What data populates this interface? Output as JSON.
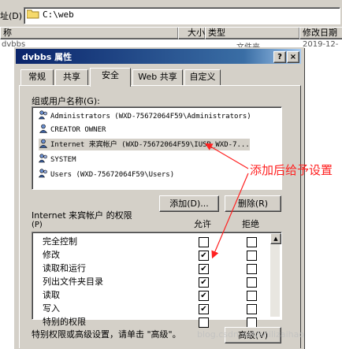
{
  "address_bar": {
    "label": "址(D)",
    "path": "C:\\web"
  },
  "file_list": {
    "columns": [
      "称",
      "大小",
      "类型",
      "修改日期"
    ],
    "row": {
      "name": "dvbbs",
      "type": "文件夹",
      "date": "2019-12-"
    }
  },
  "dialog": {
    "title": "dvbbs 属性",
    "help_label": "?",
    "close_label": "×",
    "tabs": [
      "常规",
      "共享",
      "安全",
      "Web 共享",
      "自定义"
    ],
    "active_tab": "安全",
    "users_label": "组或用户名称(G):",
    "users": [
      "Administrators (WXD-75672064F59\\Administrators)",
      "CREATOR OWNER",
      "Internet 来宾帐户 (WXD-75672064F59\\IUSR_WXD-7...",
      "SYSTEM",
      "Users (WXD-75672064F59\\Users)"
    ],
    "selected_user_index": 2,
    "add_button": "添加(D)...",
    "remove_button": "删除(R)",
    "perm_label": "Internet 来宾帐户 的权限",
    "perm_label_key": "(P)",
    "allow_header": "允许",
    "deny_header": "拒绝",
    "permissions": [
      {
        "name": "完全控制",
        "allow": false,
        "deny": false
      },
      {
        "name": "修改",
        "allow": true,
        "deny": false
      },
      {
        "name": "读取和运行",
        "allow": true,
        "deny": false
      },
      {
        "name": "列出文件夹目录",
        "allow": true,
        "deny": false
      },
      {
        "name": "读取",
        "allow": true,
        "deny": false
      },
      {
        "name": "写入",
        "allow": true,
        "deny": false
      },
      {
        "name": "特别的权限",
        "allow": false,
        "deny": false
      }
    ],
    "footer_text": "特别权限或高级设置，请单击 \"高级\"。",
    "advanced_button": "高级(V)"
  },
  "annotation": {
    "text": "添加后给予设置",
    "color": "#ff2020"
  },
  "watermark": "blog.csdn.net/shilizaihao"
}
